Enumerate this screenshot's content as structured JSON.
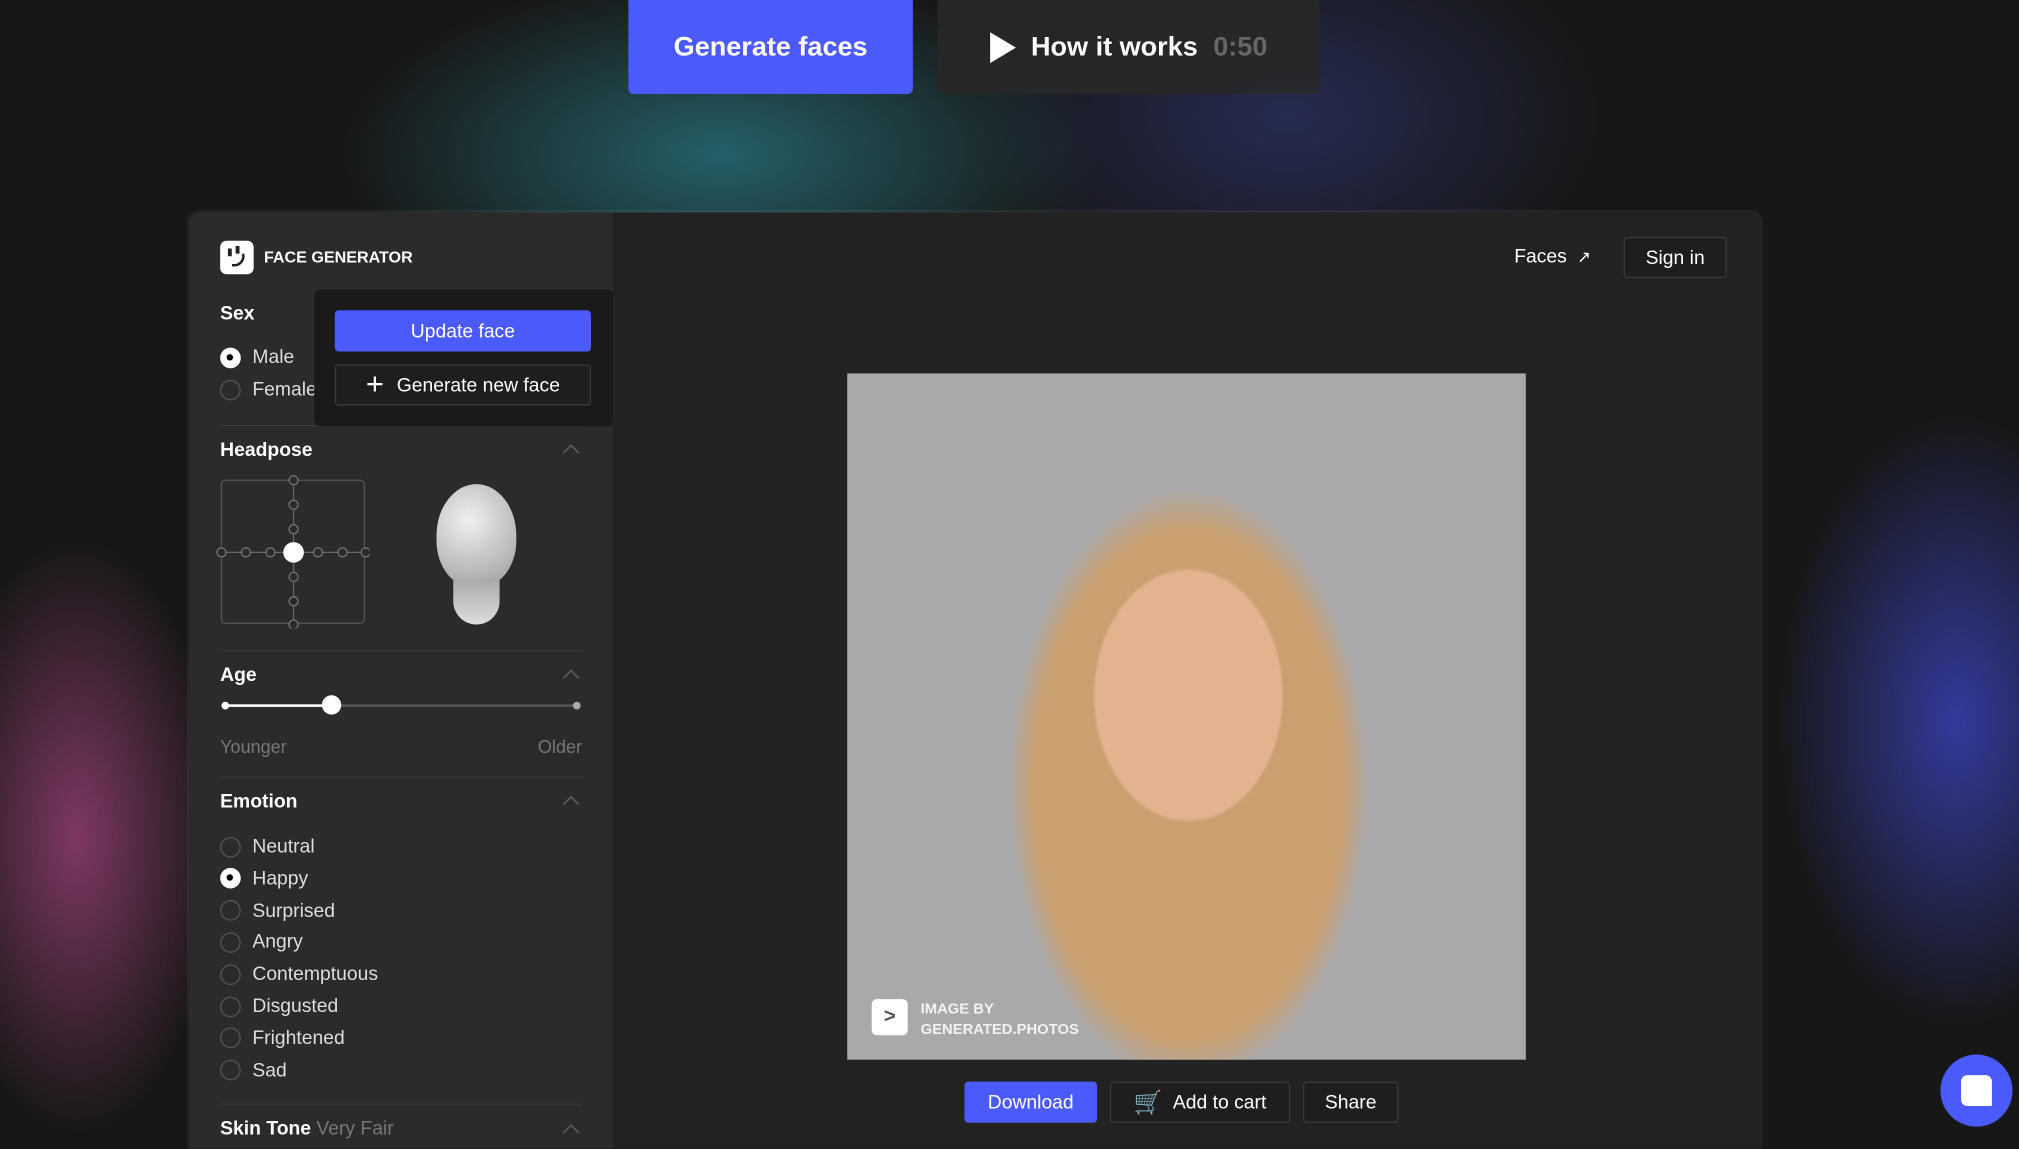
{
  "top": {
    "generate_faces": "Generate faces",
    "how_it_works": "How it works",
    "duration": "0:50"
  },
  "sidebar": {
    "logo_text": "FACE GENERATOR",
    "sex": {
      "title": "Sex",
      "options": [
        "Male",
        "Female"
      ],
      "selected": "Male"
    },
    "popover": {
      "update": "Update face",
      "generate_new": "Generate new face"
    },
    "headpose": {
      "title": "Headpose"
    },
    "age": {
      "title": "Age",
      "min_label": "Younger",
      "max_label": "Older",
      "value": 0.3
    },
    "emotion": {
      "title": "Emotion",
      "options": [
        "Neutral",
        "Happy",
        "Surprised",
        "Angry",
        "Contemptuous",
        "Disgusted",
        "Frightened",
        "Sad"
      ],
      "selected": "Happy"
    },
    "skin_tone": {
      "title": "Skin Tone",
      "value": "Very Fair"
    }
  },
  "header": {
    "faces_link": "Faces",
    "sign_in": "Sign in"
  },
  "photo": {
    "watermark_line1": "IMAGE BY",
    "watermark_line2": "GENERATED.PHOTOS"
  },
  "actions": {
    "download": "Download",
    "add_to_cart": "Add to cart",
    "share": "Share"
  },
  "colors": {
    "accent": "#4b5afa"
  }
}
